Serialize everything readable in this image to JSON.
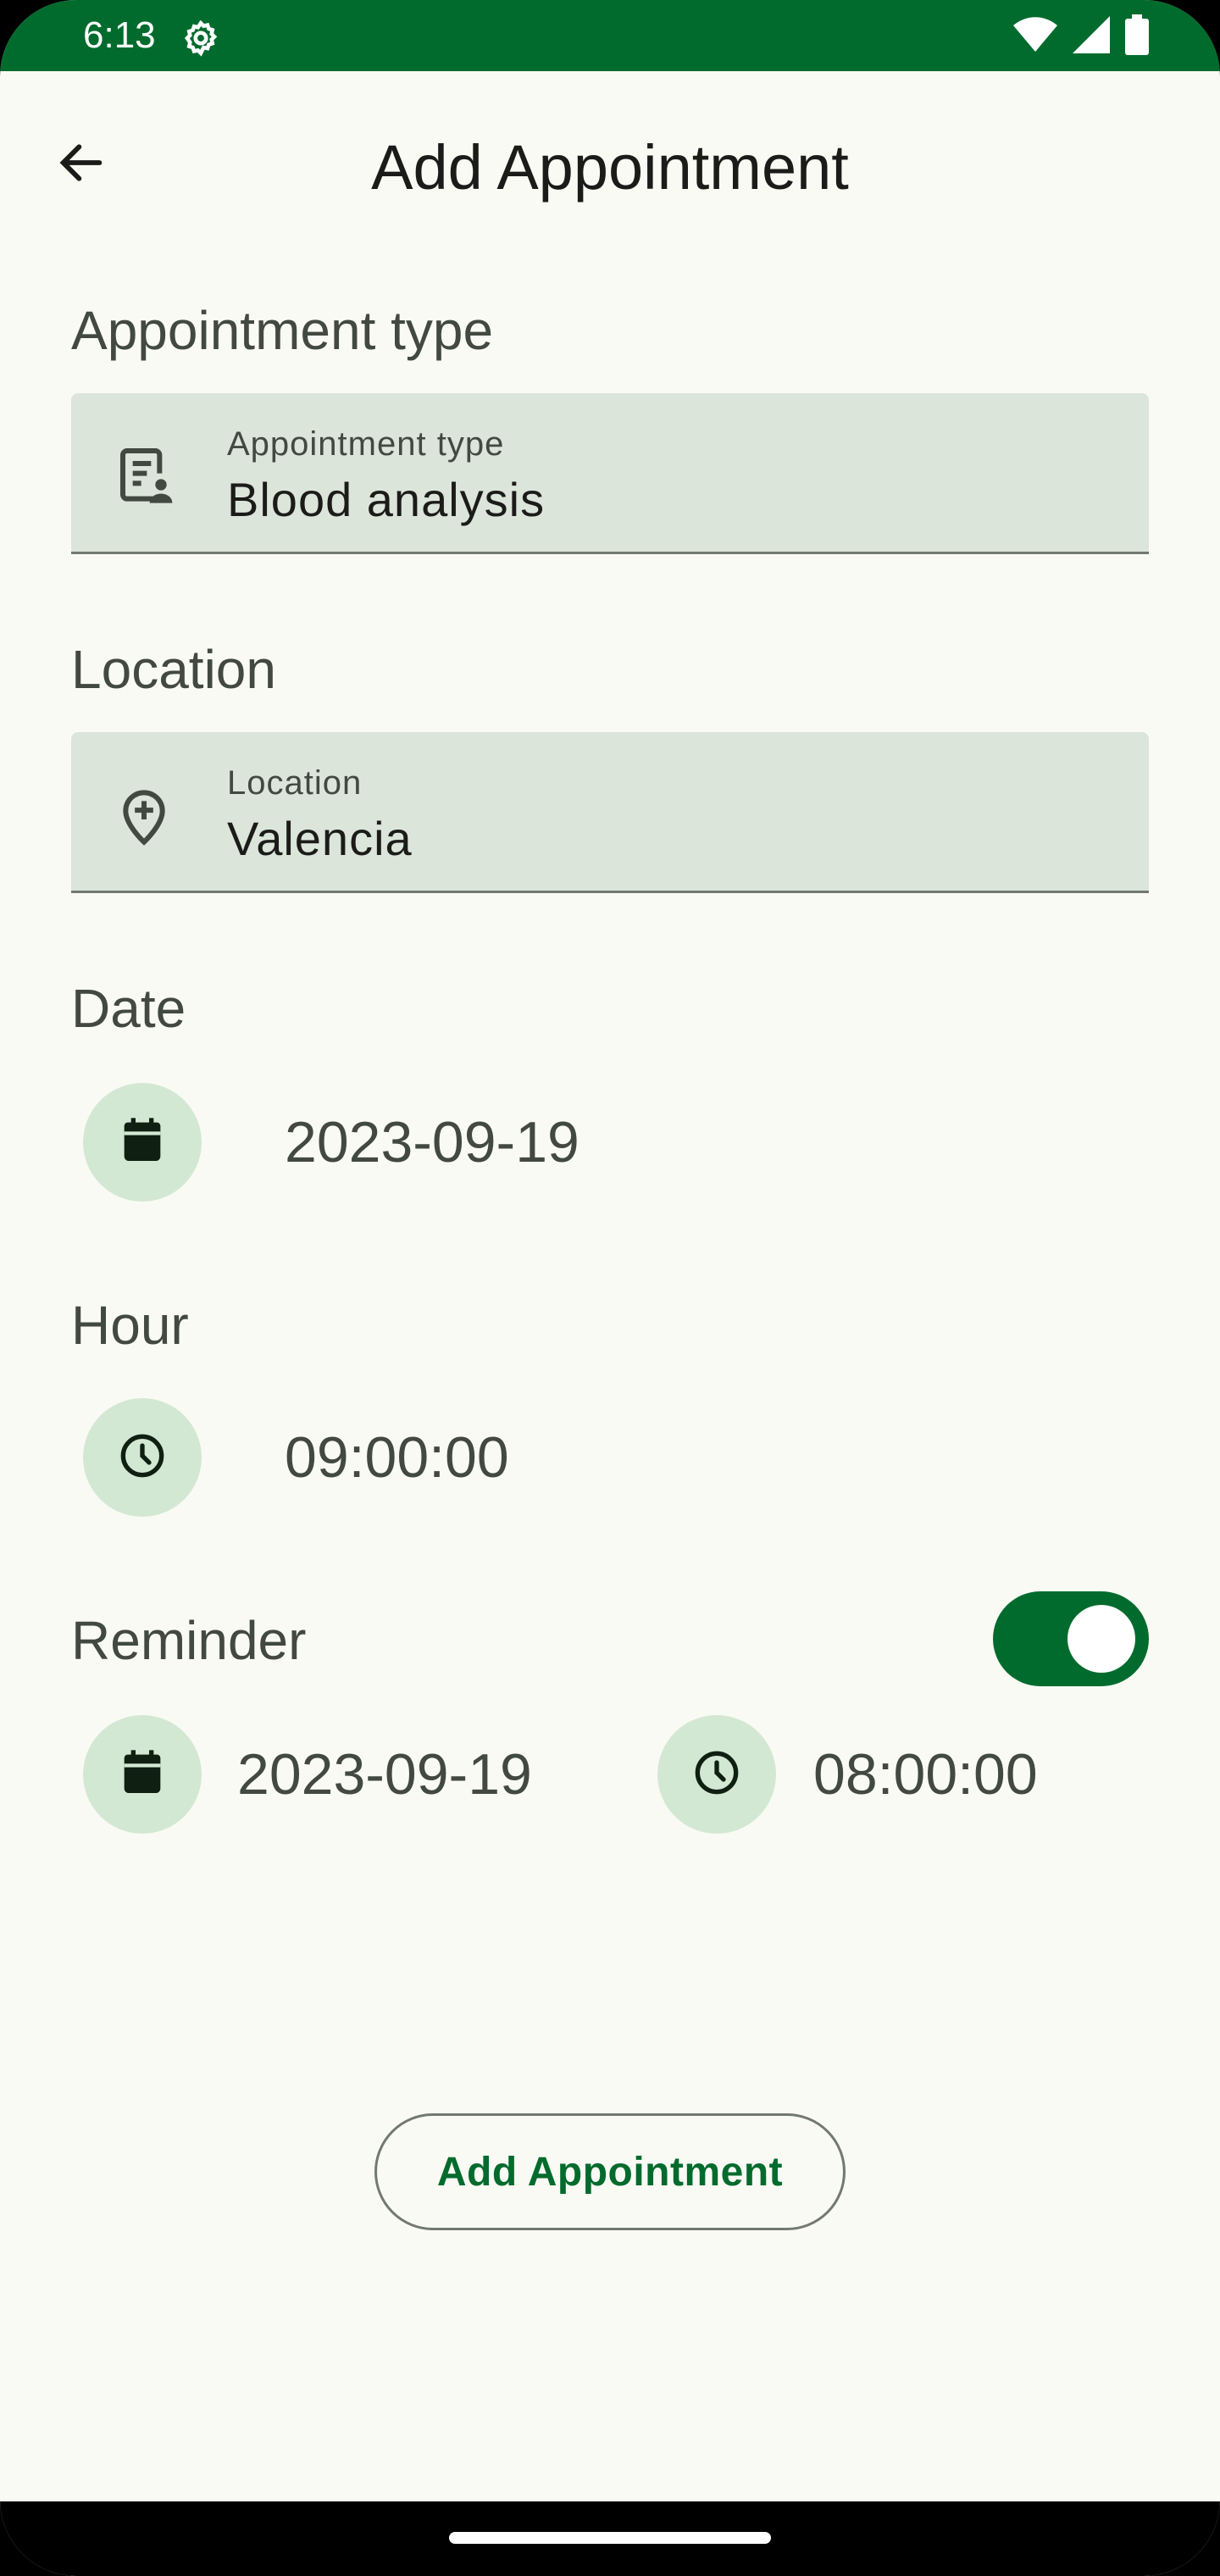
{
  "status_bar": {
    "time": "6:13"
  },
  "header": {
    "title": "Add Appointment"
  },
  "appointment_type": {
    "section_label": "Appointment type",
    "field_label": "Appointment type",
    "value": "Blood analysis"
  },
  "location": {
    "section_label": "Location",
    "field_label": "Location",
    "value": "Valencia"
  },
  "date": {
    "section_label": "Date",
    "value": "2023-09-19"
  },
  "hour": {
    "section_label": "Hour",
    "value": "09:00:00"
  },
  "reminder": {
    "section_label": "Reminder",
    "enabled": true,
    "date": "2023-09-19",
    "time": "08:00:00"
  },
  "actions": {
    "submit_label": "Add Appointment"
  },
  "colors": {
    "primary": "#006b2d",
    "tonal": "#d3e8d3",
    "field_bg": "#dce5da",
    "background": "#fafaf4"
  }
}
